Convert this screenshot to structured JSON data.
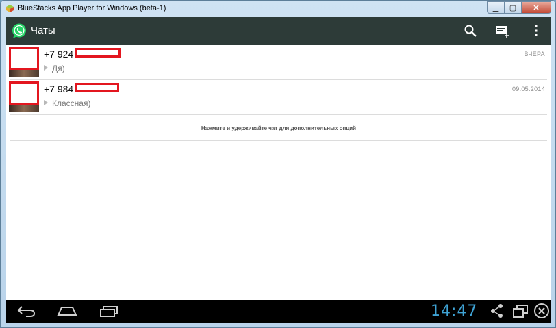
{
  "window": {
    "title": "BlueStacks App Player for Windows (beta-1)",
    "minimize_glyph": "▁",
    "maximize_glyph": "▢",
    "close_glyph": "✕"
  },
  "app": {
    "title": "Чаты",
    "icons": [
      "search-icon",
      "new-chat-icon",
      "overflow-menu-icon"
    ]
  },
  "chats": [
    {
      "name": "+7 924",
      "date": "ВЧЕРА",
      "preview": "Дя)"
    },
    {
      "name": "+7 984",
      "date": "09.05.2014",
      "preview": "Классная)"
    }
  ],
  "hint": "Нажмите и удерживайте чат для дополнительных опций",
  "navbar": {
    "clock": "14:47",
    "icons": [
      "back-icon",
      "home-icon",
      "recent-apps-icon",
      "share-icon",
      "window-mode-icon",
      "close-app-icon"
    ]
  },
  "colors": {
    "actionbar": "#2d3b38",
    "clock": "#3fa4d6",
    "redaction": "#e3161f",
    "whatsapp": "#25d366"
  }
}
